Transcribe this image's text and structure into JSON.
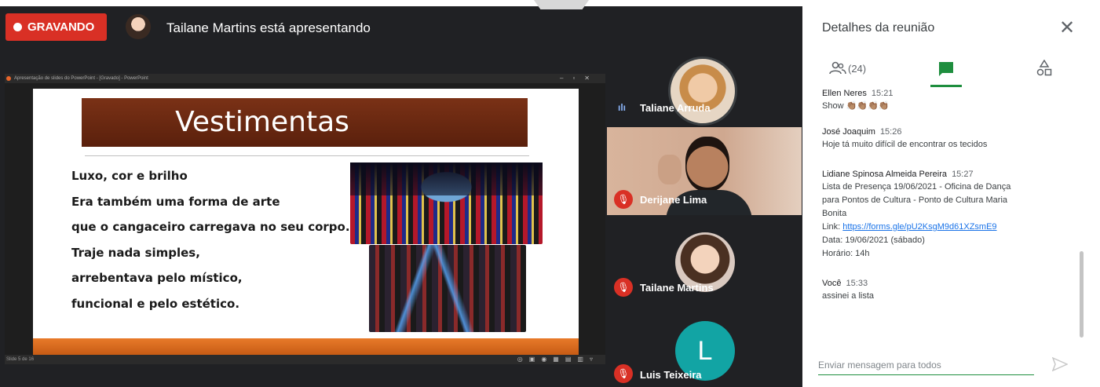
{
  "recording": {
    "label": "GRAVANDO"
  },
  "presenter": {
    "text": "Tailane Martins está apresentando"
  },
  "ppt": {
    "window_title": "Apresentação de slides do PowerPoint - [Gravado] - PowerPoint",
    "status_text": "Slide 5 de 16",
    "slide": {
      "title": "Vestimentas",
      "lines": [
        "Luxo, cor e brilho",
        "Era também uma forma de arte",
        "que o cangaceiro carregava no seu corpo.",
        "Traje nada simples,",
        "arrebentava pelo místico,",
        "funcional e pelo estético."
      ]
    }
  },
  "participants": [
    {
      "name": "Taliane Arruda",
      "state": "speaking"
    },
    {
      "name": "Derijane Lima",
      "state": "muted"
    },
    {
      "name": "Tailane Martins",
      "state": "muted"
    },
    {
      "name": "Luis Teixeira",
      "state": "muted",
      "initial": "L"
    }
  ],
  "panel": {
    "title": "Detalhes da reunião",
    "close_glyph": "✕",
    "people_count": "(24)",
    "messages": [
      {
        "sender": "Ellen Neres",
        "time": "15:21",
        "lines": [
          "Show 👏🏽👏🏽👏🏽👏🏽"
        ]
      },
      {
        "sender": "José Joaquim",
        "time": "15:26",
        "lines": [
          "Hoje tá muito difícil de encontrar os tecidos"
        ]
      },
      {
        "sender": "Lidiane Spinosa Almeida Pereira",
        "time": "15:27",
        "lines": [
          "Lista de Presença 19/06/2021 - Oficina de Dança",
          "para Pontos de Cultura -  Ponto de Cultura Maria",
          "Bonita"
        ],
        "link_prefix": "Link: ",
        "link": "https://forms.gle/pU2KsgM9d61XZsmE9",
        "extra_lines": [
          "Data: 19/06/2021 (sábado)",
          "Horário: 14h"
        ]
      },
      {
        "sender": "Você",
        "time": "15:33",
        "lines": [
          "assinei a lista"
        ]
      }
    ],
    "input_placeholder": "Enviar mensagem para todos"
  },
  "colors": {
    "record_red": "#d93025",
    "chat_green": "#1e8e3e",
    "stage_dark": "#202124",
    "avatar_teal": "#12a4a4"
  }
}
